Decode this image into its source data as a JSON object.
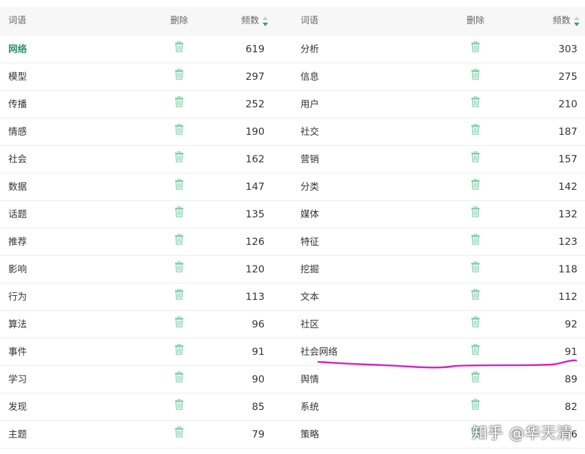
{
  "headers": {
    "word": "词语",
    "delete": "删除",
    "freq": "频数"
  },
  "colors": {
    "accent": "#2e9e6e",
    "trash": "#7fcfa8",
    "underline": "#d81ec9"
  },
  "left_rows": [
    {
      "word": "网络",
      "freq": "619"
    },
    {
      "word": "模型",
      "freq": "297"
    },
    {
      "word": "传播",
      "freq": "252"
    },
    {
      "word": "情感",
      "freq": "190"
    },
    {
      "word": "社会",
      "freq": "162"
    },
    {
      "word": "数据",
      "freq": "147"
    },
    {
      "word": "话题",
      "freq": "135"
    },
    {
      "word": "推荐",
      "freq": "126"
    },
    {
      "word": "影响",
      "freq": "120"
    },
    {
      "word": "行为",
      "freq": "113"
    },
    {
      "word": "算法",
      "freq": "96"
    },
    {
      "word": "事件",
      "freq": "91"
    },
    {
      "word": "学习",
      "freq": "90"
    },
    {
      "word": "发现",
      "freq": "85"
    },
    {
      "word": "主题",
      "freq": "79"
    }
  ],
  "right_rows": [
    {
      "word": "分析",
      "freq": "303"
    },
    {
      "word": "信息",
      "freq": "275"
    },
    {
      "word": "用户",
      "freq": "210"
    },
    {
      "word": "社交",
      "freq": "187"
    },
    {
      "word": "营销",
      "freq": "157"
    },
    {
      "word": "分类",
      "freq": "142"
    },
    {
      "word": "媒体",
      "freq": "132"
    },
    {
      "word": "特征",
      "freq": "123"
    },
    {
      "word": "挖掘",
      "freq": "118"
    },
    {
      "word": "文本",
      "freq": "112"
    },
    {
      "word": "社区",
      "freq": "92"
    },
    {
      "word": "社会网络",
      "freq": "91"
    },
    {
      "word": "舆情",
      "freq": "89"
    },
    {
      "word": "系统",
      "freq": "82"
    },
    {
      "word": "策略",
      "freq": "76"
    }
  ],
  "watermark": "知乎 @华天清"
}
